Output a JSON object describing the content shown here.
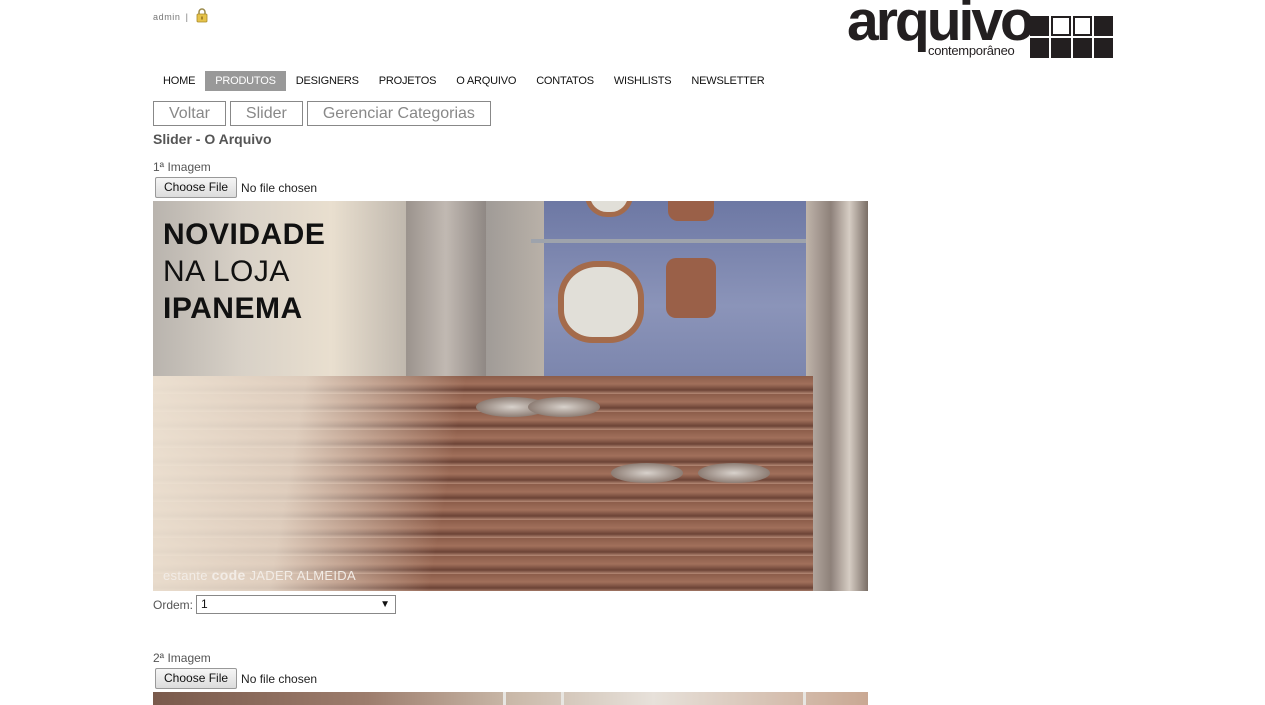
{
  "admin": {
    "user": "admin",
    "separator": "|",
    "lock_icon": "lock-icon"
  },
  "logo": {
    "word": "arquivo",
    "sub": "contemporâneo"
  },
  "nav": {
    "items": [
      {
        "label": "HOME",
        "active": false
      },
      {
        "label": "PRODUTOS",
        "active": true
      },
      {
        "label": "DESIGNERS",
        "active": false
      },
      {
        "label": "PROJETOS",
        "active": false
      },
      {
        "label": "O ARQUIVO",
        "active": false
      },
      {
        "label": "CONTATOS",
        "active": false
      },
      {
        "label": "WISHLISTS",
        "active": false
      },
      {
        "label": "NEWSLETTER",
        "active": false
      }
    ]
  },
  "actions": {
    "voltar": "Voltar",
    "slider": "Slider",
    "gerenciar": "Gerenciar Categorias"
  },
  "page_title": "Slider - O Arquivo",
  "slides": [
    {
      "label": "1ª Imagem",
      "choose_file": "Choose File",
      "file_status": "No file chosen",
      "headline": {
        "line1": "NOVIDADE",
        "line2": "NA LOJA",
        "line3": "IPANEMA"
      },
      "caption": {
        "pre": "estante",
        "bold": "code",
        "post": "JADER ALMEIDA"
      },
      "ordem_label": "Ordem:",
      "ordem_value": "1"
    },
    {
      "label": "2ª Imagem",
      "choose_file": "Choose File",
      "file_status": "No file chosen"
    }
  ],
  "colors": {
    "nav_active": "#999999",
    "text": "#555555",
    "logo": "#231f20"
  }
}
